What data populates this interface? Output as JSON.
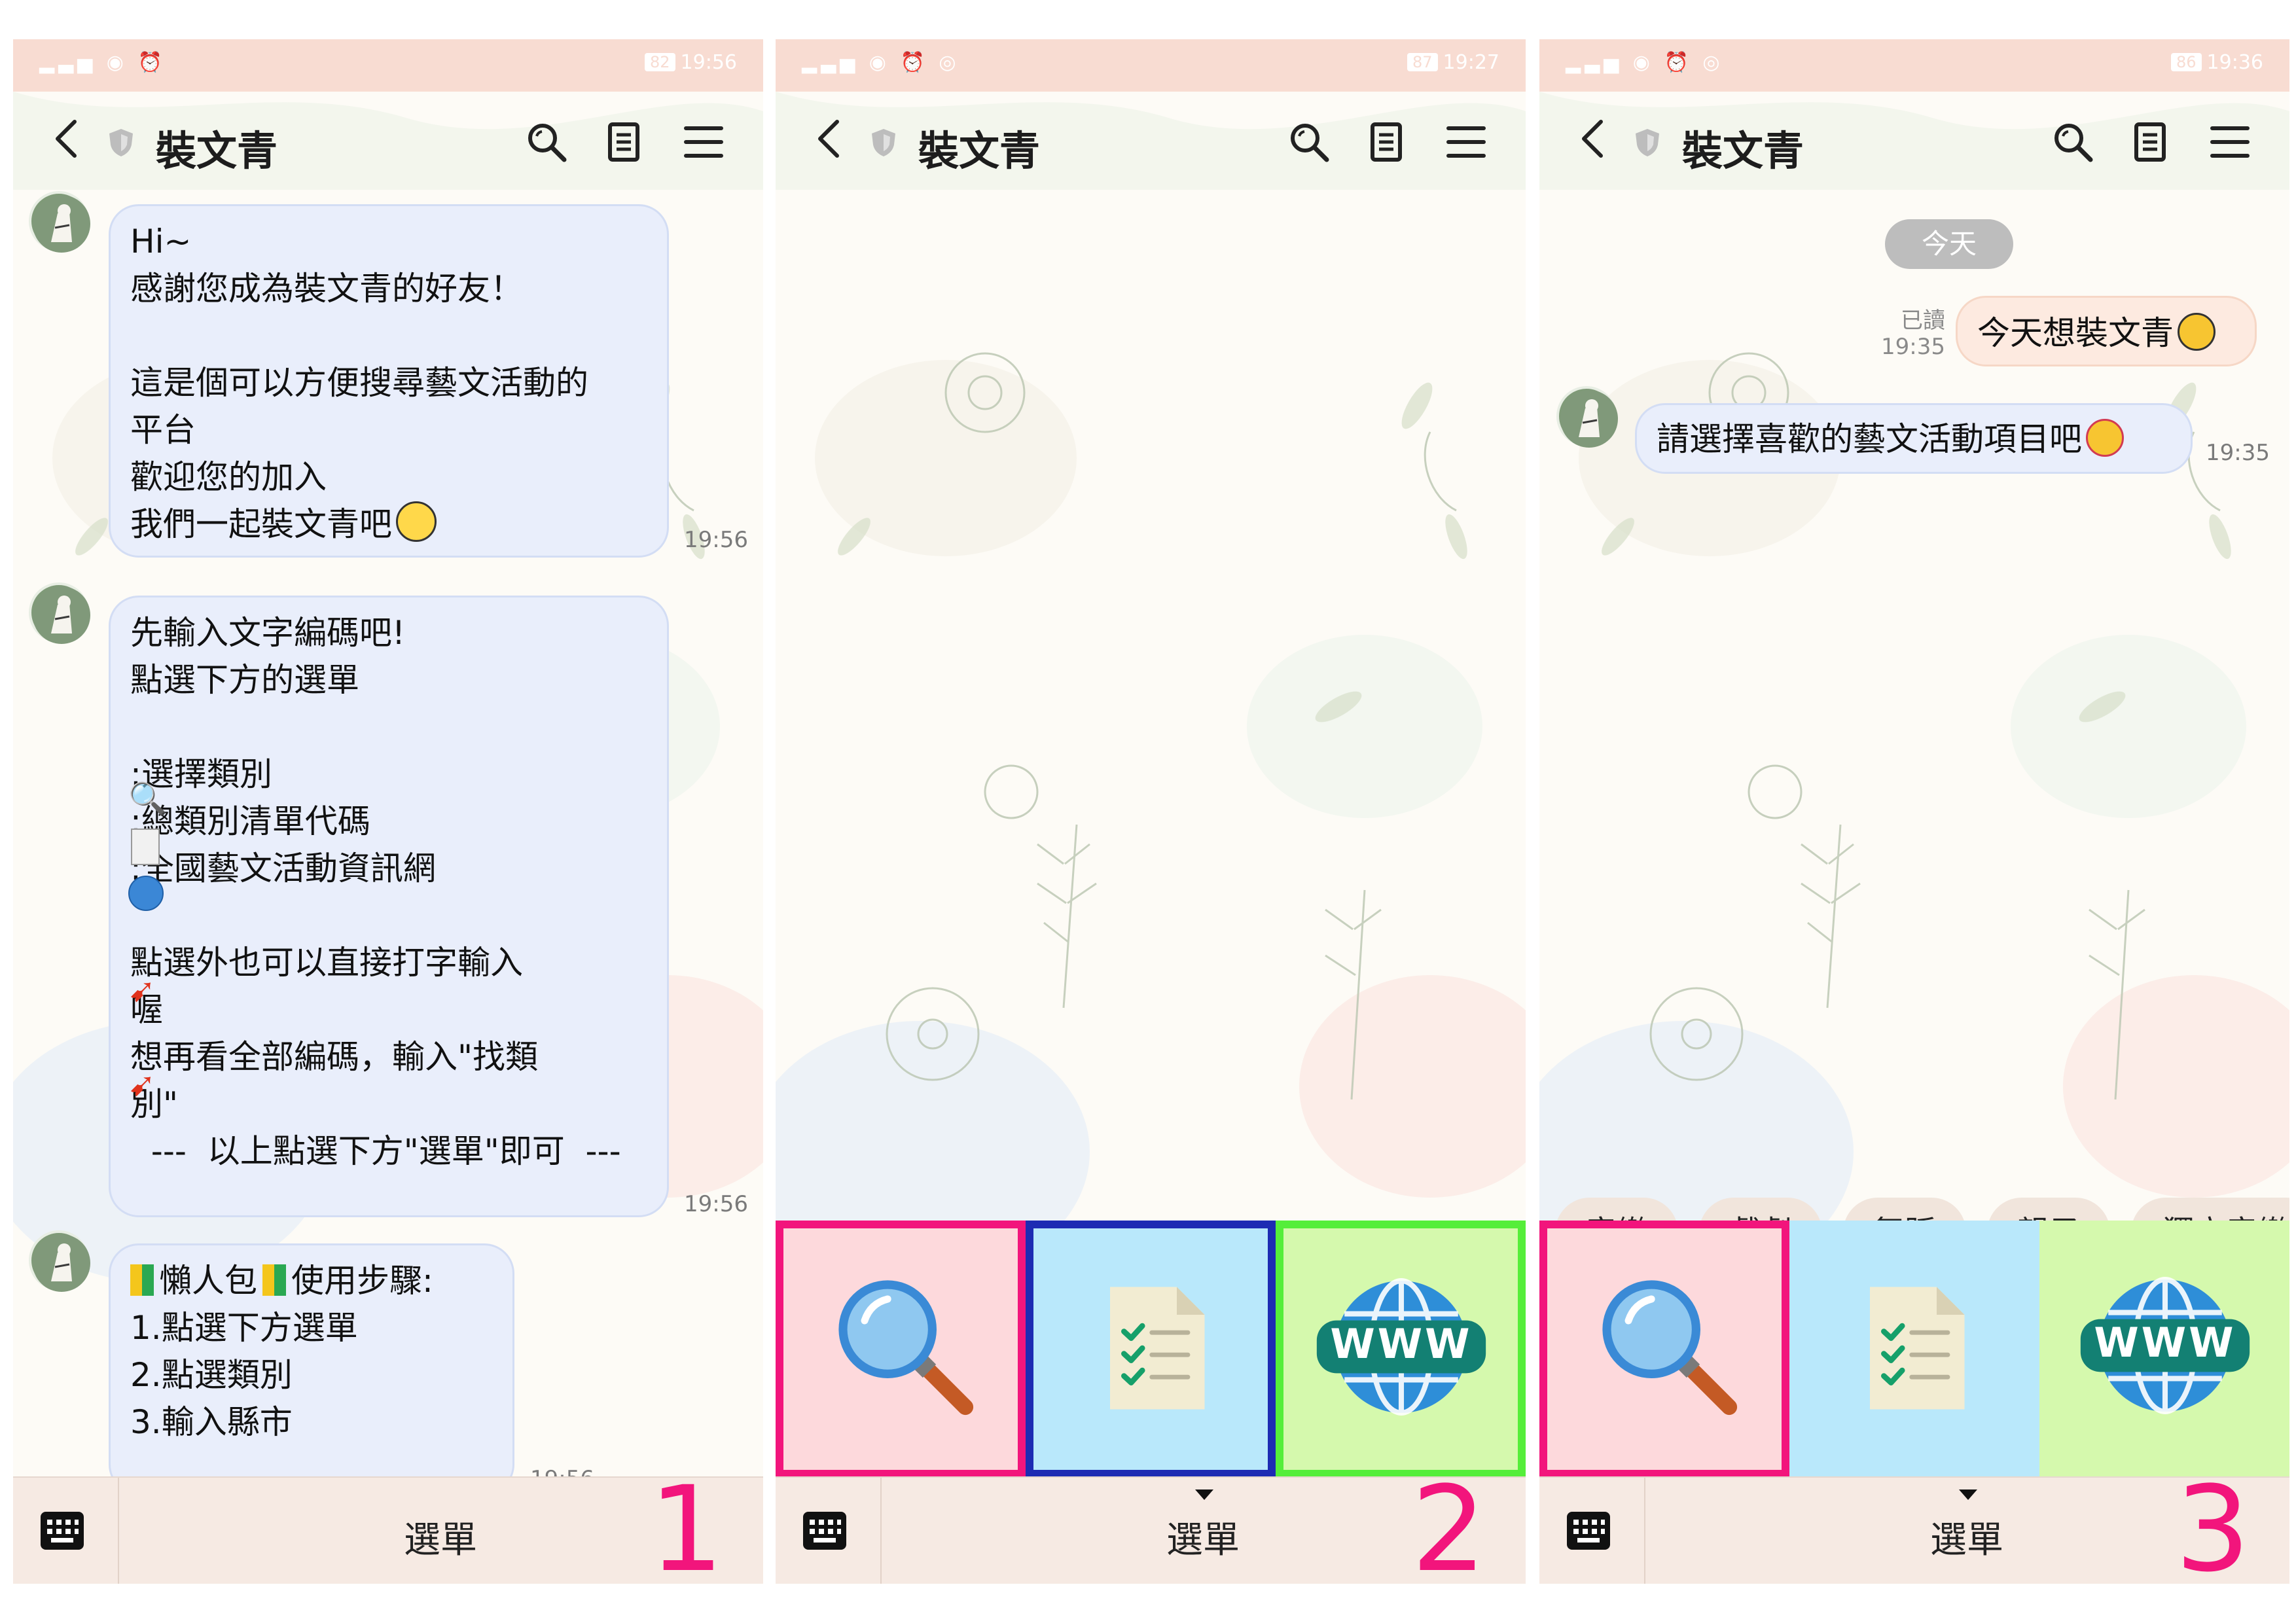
{
  "colors": {
    "accent_step": "#f2157c",
    "bubble": "#e9eefb",
    "my_bubble": "#fdeae0",
    "search_cell": "#fdd9dc",
    "list_cell": "#b9e8fb",
    "web_cell": "#d5f9ad",
    "frame_pink": "#f2157c",
    "frame_blue": "#1d2bb3",
    "frame_green": "#55ee3a"
  },
  "status": {
    "p1": {
      "battery": "82",
      "time": "19:56"
    },
    "p2": {
      "battery": "87",
      "time": "19:27"
    },
    "p3": {
      "battery": "86",
      "time": "19:36"
    }
  },
  "chat": {
    "title": "裝文青"
  },
  "panel1": {
    "msg1": "Hi~\n感謝您成為裝文青的好友！\n\n這是個可以方便搜尋藝文活動的\n平台\n歡迎您的加入\n我們一起裝文青吧",
    "msg1_time": "19:56",
    "msg2": "先輸入文字編碼吧!\n點選下方的選單\n\n:選擇類別\n:總類別清單代碼\n:全國藝文活動資訊網\n\n點選外也可以直接打字輸入\n喔\n想再看全部編碼，輸入\"找類\n別\"\n  ---  以上點選下方\"選單\"即可  ---",
    "msg2_time": "19:56",
    "msg3_title": "懶人包",
    "msg3_title_suffix": "使用步驟:",
    "msg3_body": "\n1.點選下方選單\n2.點選類別\n3.輸入縣市",
    "msg3_time": "19:56"
  },
  "panel3": {
    "date_chip": "今天",
    "read_label": "已讀",
    "my_time": "19:35",
    "my_msg": "今天想裝文青",
    "bot_msg": "請選擇喜歡的藝文活動項目吧",
    "bot_time": "19:35",
    "quick_replies": [
      "音樂",
      "戲劇",
      "舞蹈",
      "親子",
      "獨立音樂"
    ]
  },
  "bottom": {
    "menu_label": "選單"
  },
  "steps": [
    "1",
    "2",
    "3"
  ],
  "richmenu": {
    "www_label": "WWW"
  }
}
